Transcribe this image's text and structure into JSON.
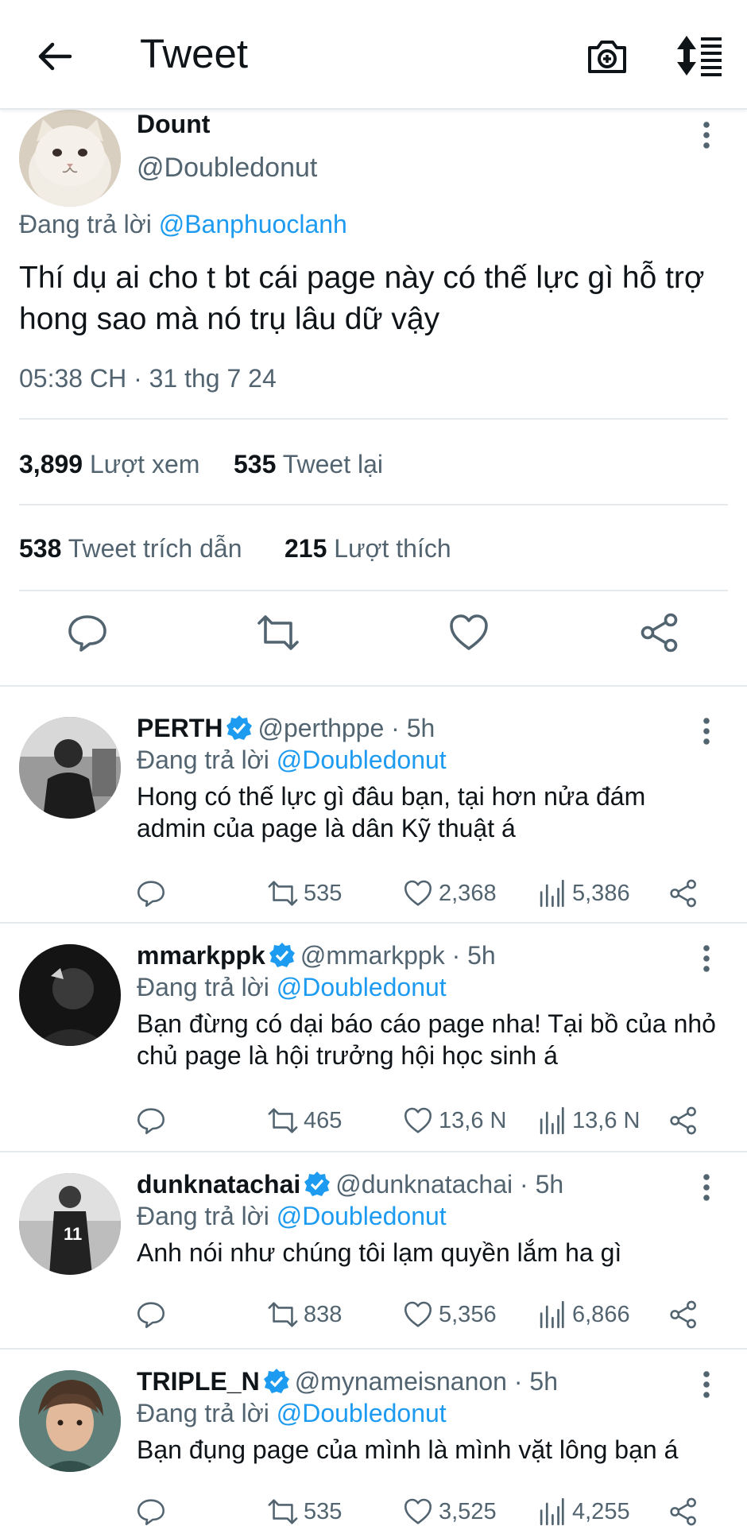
{
  "header": {
    "title": "Tweet",
    "back_icon": "arrow-left-icon",
    "camera_icon": "camera-plus-icon",
    "sort_icon": "sort-icon"
  },
  "main_tweet": {
    "name": "Dount",
    "handle": "@Doubledonut",
    "replying_prefix": "Đang trả lời",
    "replying_to": "@Banphuoclanh",
    "text": "Thí dụ ai cho t bt cái page này có thế lực gì hỗ trợ hong sao mà nó trụ lâu dữ vậy",
    "timestamp": "05:38 CH · 31 thg 7 24",
    "views_count": "3,899",
    "views_label": "Lượt xem",
    "retweets_count": "535",
    "retweets_label": "Tweet lại",
    "quotes_count": "538",
    "quotes_label": "Tweet trích dẫn",
    "likes_count": "215",
    "likes_label": "Lượt thích"
  },
  "replies": [
    {
      "name": "PERTH",
      "handle": "@perthppe",
      "time": "5h",
      "replying_prefix": "Đang trả lời",
      "replying_to": "@Doubledonut",
      "text": "Hong có thế lực gì đâu bạn, tại hơn nửa đám admin của page là dân Kỹ thuật á",
      "retweets": "535",
      "likes": "2,368",
      "views": "5,386"
    },
    {
      "name": "mmarkppk",
      "handle": "@mmarkppk",
      "time": "5h",
      "replying_prefix": "Đang trả lời",
      "replying_to": "@Doubledonut",
      "text": "Bạn đừng có dại báo cáo page nha! Tại bồ của nhỏ chủ page là hội trưởng hội học sinh á",
      "retweets": "465",
      "likes": "13,6 N",
      "views": "13,6 N"
    },
    {
      "name": "dunknatachai",
      "handle": "@dunknatachai",
      "time": "5h",
      "replying_prefix": "Đang trả lời",
      "replying_to": "@Doubledonut",
      "text": "Anh nói như chúng tôi lạm quyền lắm ha gì",
      "retweets": "838",
      "likes": "5,356",
      "views": "6,866"
    },
    {
      "name": "TRIPLE_N",
      "handle": "@mynameisnanon",
      "time": "5h",
      "replying_prefix": "Đang trả lời",
      "replying_to": "@Doubledonut",
      "text": "Bạn đụng page của mình là mình vặt lông bạn á",
      "retweets": "535",
      "likes": "3,525",
      "views": "4,255"
    }
  ],
  "colors": {
    "accent": "#1d9bf0",
    "text_primary": "#0f1419",
    "text_secondary": "#536471",
    "divider": "#e6e9eb"
  }
}
